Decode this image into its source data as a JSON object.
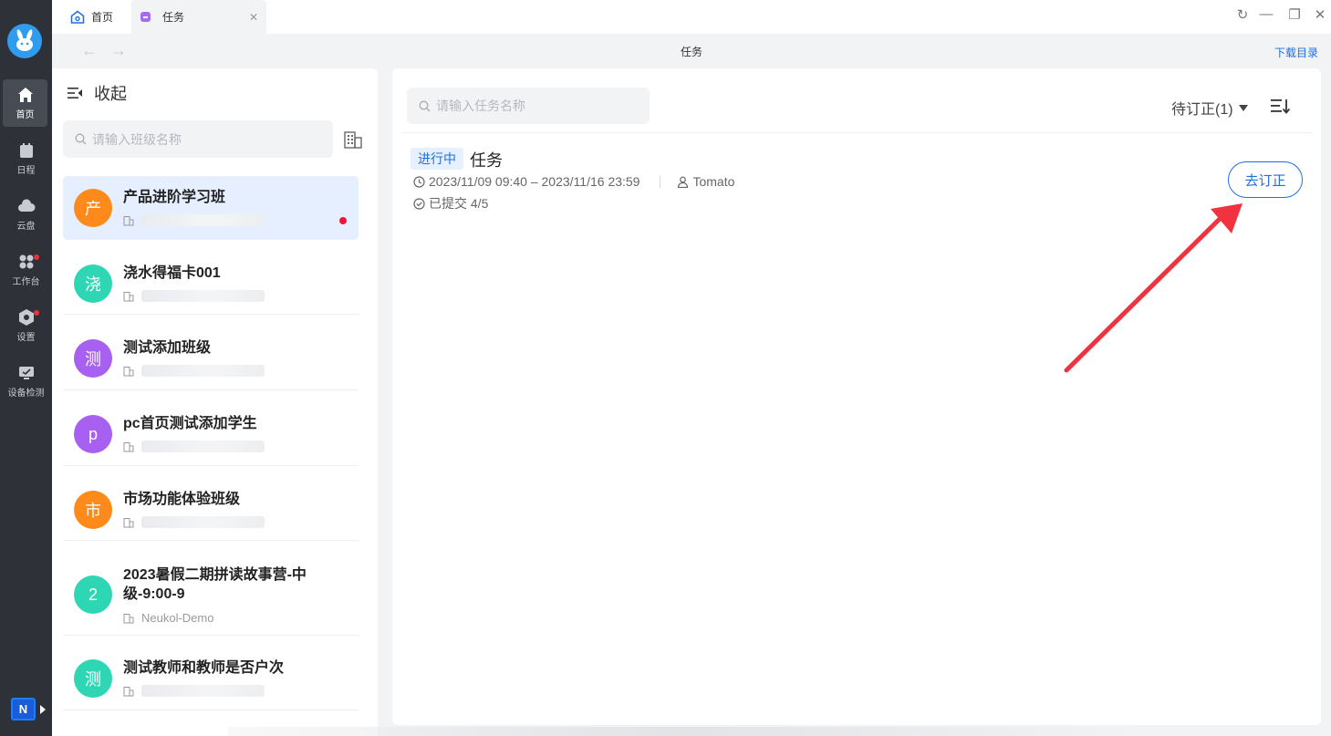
{
  "tabs": [
    {
      "label": "首页"
    },
    {
      "label": "任务"
    }
  ],
  "nav": {
    "title": "任务",
    "download": "下载目录"
  },
  "rail": {
    "items": [
      {
        "label": "首页",
        "icon": "home-icon"
      },
      {
        "label": "日程",
        "icon": "calendar-icon"
      },
      {
        "label": "云盘",
        "icon": "cloud-icon"
      },
      {
        "label": "工作台",
        "icon": "apps-icon"
      },
      {
        "label": "设置",
        "icon": "settings-icon"
      },
      {
        "label": "设备检测",
        "icon": "device-check-icon"
      }
    ],
    "badge_letter": "N"
  },
  "left_panel": {
    "collapse_label": "收起",
    "search_placeholder": "请输入班级名称",
    "classes": [
      {
        "avatar": "产",
        "name": "产品进阶学习班",
        "sub": ""
      },
      {
        "avatar": "浇",
        "name": "浇水得福卡001",
        "sub": ""
      },
      {
        "avatar": "测",
        "name": "测试添加班级",
        "sub": ""
      },
      {
        "avatar": "p",
        "name": "pc首页测试添加学生",
        "sub": ""
      },
      {
        "avatar": "市",
        "name": "市场功能体验班级",
        "sub": ""
      },
      {
        "avatar": "2",
        "name": "2023暑假二期拼读故事营-中级-9:00-9",
        "sub": "Neukol-Demo"
      },
      {
        "avatar": "测",
        "name": "测试教师和教师是否户次",
        "sub": ""
      }
    ]
  },
  "right_panel": {
    "search_placeholder": "请输入任务名称",
    "filter_label": "待订正(1)",
    "task": {
      "status": "进行中",
      "name": "任务",
      "time_range": "2023/11/09 09:40 – 2023/11/16 23:59",
      "owner": "Tomato",
      "submitted": "已提交 4/5",
      "action": "去订正"
    }
  },
  "colors": {
    "accent": "#1f6fe0",
    "rail_bg": "#2e3138",
    "annotation_arrow": "#f0333f"
  }
}
